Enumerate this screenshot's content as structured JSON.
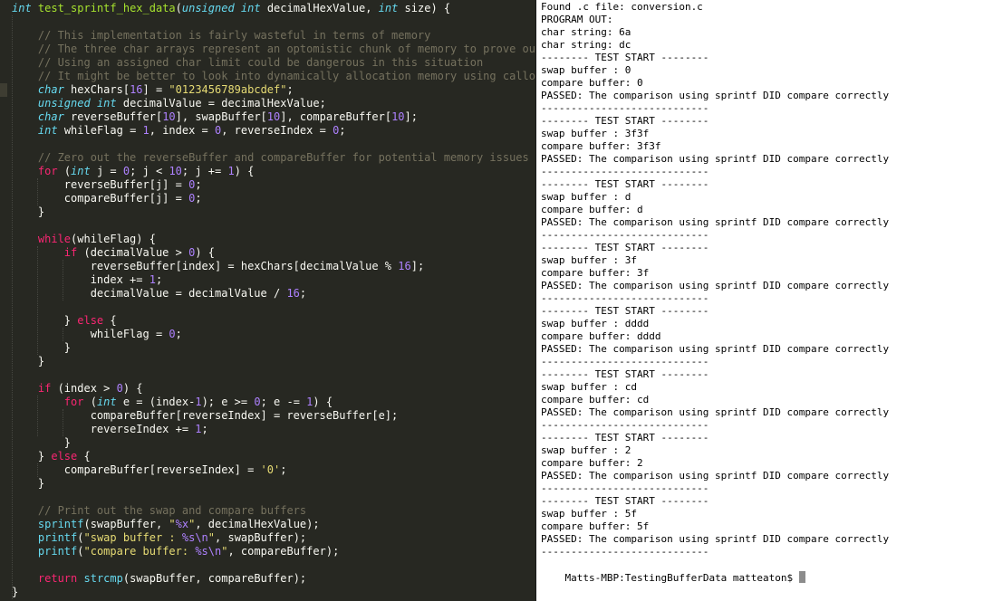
{
  "editor": {
    "theme_colors": {
      "background": "#272822",
      "keyword": "#f92672",
      "type": "#66d9ef",
      "function": "#a6e22e",
      "number": "#ae81ff",
      "string": "#e6db74",
      "comment": "#75715e"
    },
    "code_lines": [
      [
        {
          "t": "int",
          "c": "ty"
        },
        {
          "t": " "
        },
        {
          "t": "test_sprintf_hex_data",
          "c": "fn"
        },
        {
          "t": "("
        },
        {
          "t": "unsigned",
          "c": "ty"
        },
        {
          "t": " "
        },
        {
          "t": "int",
          "c": "ty"
        },
        {
          "t": " decimalHexValue, "
        },
        {
          "t": "int",
          "c": "ty"
        },
        {
          "t": " size) {"
        }
      ],
      [],
      [
        {
          "t": "    "
        },
        {
          "t": "// This implementation is fairly wasteful in terms of memory",
          "c": "cm"
        }
      ],
      [
        {
          "t": "    "
        },
        {
          "t": "// The three char arrays represent an optomistic chunk of memory to prove our f",
          "c": "cm"
        }
      ],
      [
        {
          "t": "    "
        },
        {
          "t": "// Using an assigned char limit could be dangerous in this situation",
          "c": "cm"
        }
      ],
      [
        {
          "t": "    "
        },
        {
          "t": "// It might be better to look into dynamically allocation memory using calloc i",
          "c": "cm"
        }
      ],
      [
        {
          "t": "    "
        },
        {
          "t": "char",
          "c": "ty"
        },
        {
          "t": " hexChars["
        },
        {
          "t": "16",
          "c": "num"
        },
        {
          "t": "] = "
        },
        {
          "t": "\"0123456789abcdef\"",
          "c": "str"
        },
        {
          "t": ";"
        }
      ],
      [
        {
          "t": "    "
        },
        {
          "t": "unsigned",
          "c": "ty"
        },
        {
          "t": " "
        },
        {
          "t": "int",
          "c": "ty"
        },
        {
          "t": " decimalValue = decimalHexValue;"
        }
      ],
      [
        {
          "t": "    "
        },
        {
          "t": "char",
          "c": "ty"
        },
        {
          "t": " reverseBuffer["
        },
        {
          "t": "10",
          "c": "num"
        },
        {
          "t": "], swapBuffer["
        },
        {
          "t": "10",
          "c": "num"
        },
        {
          "t": "], compareBuffer["
        },
        {
          "t": "10",
          "c": "num"
        },
        {
          "t": "];"
        }
      ],
      [
        {
          "t": "    "
        },
        {
          "t": "int",
          "c": "ty"
        },
        {
          "t": " whileFlag = "
        },
        {
          "t": "1",
          "c": "num"
        },
        {
          "t": ", index = "
        },
        {
          "t": "0",
          "c": "num"
        },
        {
          "t": ", reverseIndex = "
        },
        {
          "t": "0",
          "c": "num"
        },
        {
          "t": ";"
        }
      ],
      [],
      [
        {
          "t": "    "
        },
        {
          "t": "// Zero out the reverseBuffer and compareBuffer for potential memory issues",
          "c": "cm"
        }
      ],
      [
        {
          "t": "    "
        },
        {
          "t": "for",
          "c": "kw"
        },
        {
          "t": " ("
        },
        {
          "t": "int",
          "c": "ty"
        },
        {
          "t": " j = "
        },
        {
          "t": "0",
          "c": "num"
        },
        {
          "t": "; j < "
        },
        {
          "t": "10",
          "c": "num"
        },
        {
          "t": "; j += "
        },
        {
          "t": "1",
          "c": "num"
        },
        {
          "t": ") {"
        }
      ],
      [
        {
          "t": "        reverseBuffer[j] = "
        },
        {
          "t": "0",
          "c": "num"
        },
        {
          "t": ";"
        }
      ],
      [
        {
          "t": "        compareBuffer[j] = "
        },
        {
          "t": "0",
          "c": "num"
        },
        {
          "t": ";"
        }
      ],
      [
        {
          "t": "    }"
        }
      ],
      [],
      [
        {
          "t": "    "
        },
        {
          "t": "while",
          "c": "kw"
        },
        {
          "t": "(whileFlag) {"
        }
      ],
      [
        {
          "t": "        "
        },
        {
          "t": "if",
          "c": "kw"
        },
        {
          "t": " (decimalValue > "
        },
        {
          "t": "0",
          "c": "num"
        },
        {
          "t": ") {"
        }
      ],
      [
        {
          "t": "            reverseBuffer[index] = hexChars[decimalValue % "
        },
        {
          "t": "16",
          "c": "num"
        },
        {
          "t": "];"
        }
      ],
      [
        {
          "t": "            index += "
        },
        {
          "t": "1",
          "c": "num"
        },
        {
          "t": ";"
        }
      ],
      [
        {
          "t": "            decimalValue = decimalValue / "
        },
        {
          "t": "16",
          "c": "num"
        },
        {
          "t": ";"
        }
      ],
      [],
      [
        {
          "t": "        } "
        },
        {
          "t": "else",
          "c": "kw"
        },
        {
          "t": " {"
        }
      ],
      [
        {
          "t": "            whileFlag = "
        },
        {
          "t": "0",
          "c": "num"
        },
        {
          "t": ";"
        }
      ],
      [
        {
          "t": "        }"
        }
      ],
      [
        {
          "t": "    }"
        }
      ],
      [],
      [
        {
          "t": "    "
        },
        {
          "t": "if",
          "c": "kw"
        },
        {
          "t": " (index > "
        },
        {
          "t": "0",
          "c": "num"
        },
        {
          "t": ") {"
        }
      ],
      [
        {
          "t": "        "
        },
        {
          "t": "for",
          "c": "kw"
        },
        {
          "t": " ("
        },
        {
          "t": "int",
          "c": "ty"
        },
        {
          "t": " e = (index-"
        },
        {
          "t": "1",
          "c": "num"
        },
        {
          "t": "); e >= "
        },
        {
          "t": "0",
          "c": "num"
        },
        {
          "t": "; e -= "
        },
        {
          "t": "1",
          "c": "num"
        },
        {
          "t": ") {"
        }
      ],
      [
        {
          "t": "            compareBuffer[reverseIndex] = reverseBuffer[e];"
        }
      ],
      [
        {
          "t": "            reverseIndex += "
        },
        {
          "t": "1",
          "c": "num"
        },
        {
          "t": ";"
        }
      ],
      [
        {
          "t": "        }"
        }
      ],
      [
        {
          "t": "    } "
        },
        {
          "t": "else",
          "c": "kw"
        },
        {
          "t": " {"
        }
      ],
      [
        {
          "t": "        compareBuffer[reverseIndex] = "
        },
        {
          "t": "'0'",
          "c": "str"
        },
        {
          "t": ";"
        }
      ],
      [
        {
          "t": "    }"
        }
      ],
      [],
      [
        {
          "t": "    "
        },
        {
          "t": "// Print out the swap and compare buffers",
          "c": "cm"
        }
      ],
      [
        {
          "t": "    "
        },
        {
          "t": "sprintf",
          "c": "bi"
        },
        {
          "t": "(swapBuffer, "
        },
        {
          "t": "\"",
          "c": "str"
        },
        {
          "t": "%x",
          "c": "esc"
        },
        {
          "t": "\"",
          "c": "str"
        },
        {
          "t": ", decimalHexValue);"
        }
      ],
      [
        {
          "t": "    "
        },
        {
          "t": "printf",
          "c": "bi"
        },
        {
          "t": "("
        },
        {
          "t": "\"swap buffer : ",
          "c": "str"
        },
        {
          "t": "%s\\n",
          "c": "esc"
        },
        {
          "t": "\"",
          "c": "str"
        },
        {
          "t": ", swapBuffer);"
        }
      ],
      [
        {
          "t": "    "
        },
        {
          "t": "printf",
          "c": "bi"
        },
        {
          "t": "("
        },
        {
          "t": "\"compare buffer: ",
          "c": "str"
        },
        {
          "t": "%s\\n",
          "c": "esc"
        },
        {
          "t": "\"",
          "c": "str"
        },
        {
          "t": ", compareBuffer);"
        }
      ],
      [],
      [
        {
          "t": "    "
        },
        {
          "t": "return",
          "c": "kw"
        },
        {
          "t": " "
        },
        {
          "t": "strcmp",
          "c": "bi"
        },
        {
          "t": "(swapBuffer, compareBuffer);"
        }
      ],
      [
        {
          "t": "}"
        }
      ]
    ]
  },
  "terminal": {
    "lines": [
      "Found .c file: conversion.c",
      "PROGRAM OUT:",
      "char string: 6a",
      "char string: dc",
      "-------- TEST START --------",
      "swap buffer : 0",
      "compare buffer: 0",
      "PASSED: The comparison using sprintf DID compare correctly",
      "----------------------------",
      "-------- TEST START --------",
      "swap buffer : 3f3f",
      "compare buffer: 3f3f",
      "PASSED: The comparison using sprintf DID compare correctly",
      "----------------------------",
      "-------- TEST START --------",
      "swap buffer : d",
      "compare buffer: d",
      "PASSED: The comparison using sprintf DID compare correctly",
      "----------------------------",
      "-------- TEST START --------",
      "swap buffer : 3f",
      "compare buffer: 3f",
      "PASSED: The comparison using sprintf DID compare correctly",
      "----------------------------",
      "-------- TEST START --------",
      "swap buffer : dddd",
      "compare buffer: dddd",
      "PASSED: The comparison using sprintf DID compare correctly",
      "----------------------------",
      "-------- TEST START --------",
      "swap buffer : cd",
      "compare buffer: cd",
      "PASSED: The comparison using sprintf DID compare correctly",
      "----------------------------",
      "-------- TEST START --------",
      "swap buffer : 2",
      "compare buffer: 2",
      "PASSED: The comparison using sprintf DID compare correctly",
      "----------------------------",
      "-------- TEST START --------",
      "swap buffer : 5f",
      "compare buffer: 5f",
      "PASSED: The comparison using sprintf DID compare correctly",
      "----------------------------"
    ],
    "prompt": "Matts-MBP:TestingBufferData matteaton$ "
  }
}
